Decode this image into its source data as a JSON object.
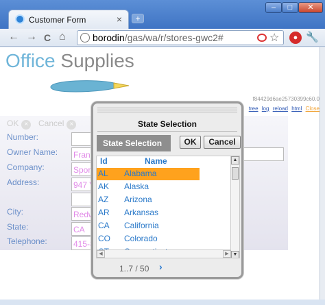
{
  "browser": {
    "tab_title": "Customer Form",
    "tab_close": "×",
    "new_tab": "+",
    "window_buttons": {
      "minimize": "–",
      "maximize": "□",
      "close": "✕"
    },
    "nav": {
      "back": "←",
      "forward": "→",
      "reload": "C",
      "home": "⌂"
    },
    "url_host": "borodin",
    "url_path": "/gas/wa/r/stores-gwc2#",
    "star": "☆",
    "ext_icon": "●",
    "wrench": "🔧"
  },
  "page": {
    "logo_office": "Office",
    "logo_supplies": " Supplies",
    "hash": "f84429d6ae25730399c60.0",
    "dev_links": [
      "tree",
      "log",
      "reload",
      "html",
      "Close"
    ],
    "form_buttons": {
      "ok": "OK",
      "cancel": "Cancel"
    },
    "fields": [
      {
        "label": "Number:",
        "value": ""
      },
      {
        "label": "Owner Name:",
        "value": "Frank"
      },
      {
        "label": "Company:",
        "value": "Sport"
      },
      {
        "label": "Address:",
        "value": "947 V"
      },
      {
        "label": "",
        "value": ""
      },
      {
        "label": "City:",
        "value": "Redw"
      },
      {
        "label": "State:",
        "value": "CA"
      },
      {
        "label": "Telephone:",
        "value": "415-8"
      }
    ]
  },
  "dialog": {
    "title": "State Selection",
    "subtitle": "State Selection",
    "ok_label": "OK",
    "cancel_label": "Cancel",
    "columns": {
      "id": "Id",
      "name": "Name"
    },
    "rows": [
      {
        "id": "AL",
        "name": "Alabama",
        "selected": true
      },
      {
        "id": "AK",
        "name": "Alaska"
      },
      {
        "id": "AZ",
        "name": "Arizona"
      },
      {
        "id": "AR",
        "name": "Arkansas"
      },
      {
        "id": "CA",
        "name": "California"
      },
      {
        "id": "CO",
        "name": "Colorado"
      },
      {
        "id": "CT",
        "name": "Connecticut"
      }
    ],
    "pager_text": "1..7 / 50",
    "pager_next": "›"
  }
}
